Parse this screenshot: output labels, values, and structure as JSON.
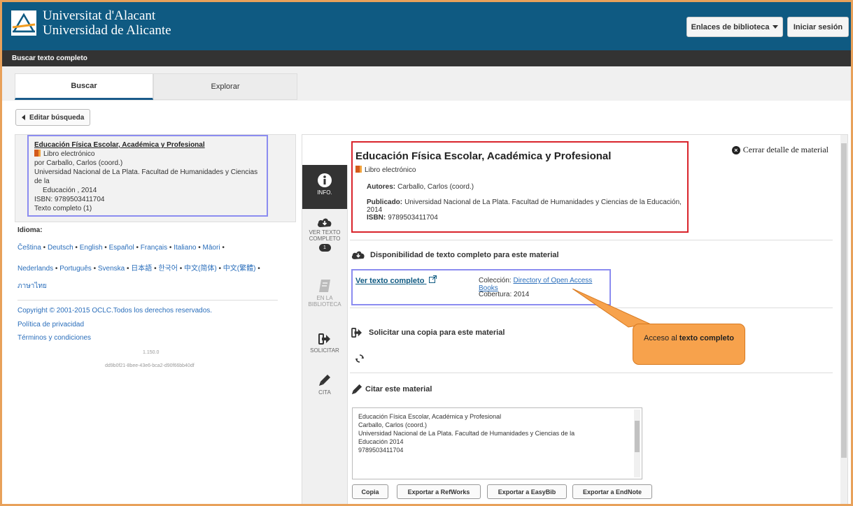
{
  "header": {
    "uni_line1": "Universitat d'Alacant",
    "uni_line2": "Universidad de Alicante",
    "library_links_label": "Enlaces de biblioteca",
    "login_label": "Iniciar sesión",
    "brand_color": "#0f5a82"
  },
  "subbar": {
    "title": "Buscar texto completo"
  },
  "tabs": [
    {
      "label": "Buscar"
    },
    {
      "label": "Explorar"
    }
  ],
  "edit_search_label": "Editar búsqueda",
  "result": {
    "title": "Educación Física Escolar, Académica y Profesional",
    "type": "Libro electrónico",
    "author": "por Carballo, Carlos (coord.)",
    "publisher_line1": "Universidad Nacional de La Plata. Facultad de Humanidades y Ciencias de la",
    "publisher_line2": "Educación , 2014",
    "isbn": "ISBN: 9789503411704",
    "fulltext": "Texto completo (1)"
  },
  "language": {
    "label": "Idioma:",
    "line1": [
      "Čeština",
      "Deutsch",
      "English",
      "Español",
      "Français",
      "Italiano",
      "Māori"
    ],
    "line2": [
      "Nederlands",
      "Português",
      "Svenska",
      "日本語",
      "한국어",
      "中文(简体)",
      "中文(繁體)"
    ],
    "line3": [
      "ภาษาไทย"
    ]
  },
  "footer": {
    "copyright": "Copyright © 2001-2015 OCLC.Todos los derechos reservados.",
    "privacy": "Política de privacidad",
    "terms": "Términos y condiciones",
    "version": "1.150.0",
    "build": "dd9b0f21-8bee-43e6-bca2-d90f66bb40df"
  },
  "sidenav": {
    "info": "INFO.",
    "fulltext_l1": "VER TEXTO",
    "fulltext_l2": "COMPLETO",
    "fulltext_count": "1",
    "library_l1": "EN LA",
    "library_l2": "BIBLIOTECA",
    "request": "SOLICITAR",
    "cite": "CITA"
  },
  "detail": {
    "close_label": "Cerrar detalle de material",
    "title": "Educación Física Escolar, Académica y Profesional",
    "type": "Libro electrónico",
    "authors_label": "Autores:",
    "authors_value": "Carballo, Carlos (coord.)",
    "published_label": "Publicado:",
    "published_value": "Universidad Nacional de La Plata. Facultad de Humanidades y Ciencias de la Educación, 2014",
    "isbn_label": "ISBN:",
    "isbn_value": "9789503411704",
    "availability_heading": "Disponibilidad de texto completo para este material",
    "fulltext_link": "Ver texto completo",
    "collection_label": "Colección:",
    "collection_value": "Directory of Open Access Books",
    "coverage_label": "Cobertura:",
    "coverage_value": "2014",
    "request_heading": "Solicitar una copia para este material",
    "cite_heading": "Citar este material",
    "cite_lines": [
      "Educación Física Escolar, Académica y Profesional",
      "Carballo, Carlos (coord.)",
      "Universidad Nacional de La Plata. Facultad de Humanidades y Ciencias de la",
      "Educación 2014",
      "9789503411704"
    ],
    "buttons": [
      "Copia",
      "Exportar a RefWorks",
      "Exportar a EasyBib",
      "Exportar a EndNote"
    ]
  },
  "callout": {
    "text_plain": "Acceso al",
    "text_bold": "texto completo"
  }
}
